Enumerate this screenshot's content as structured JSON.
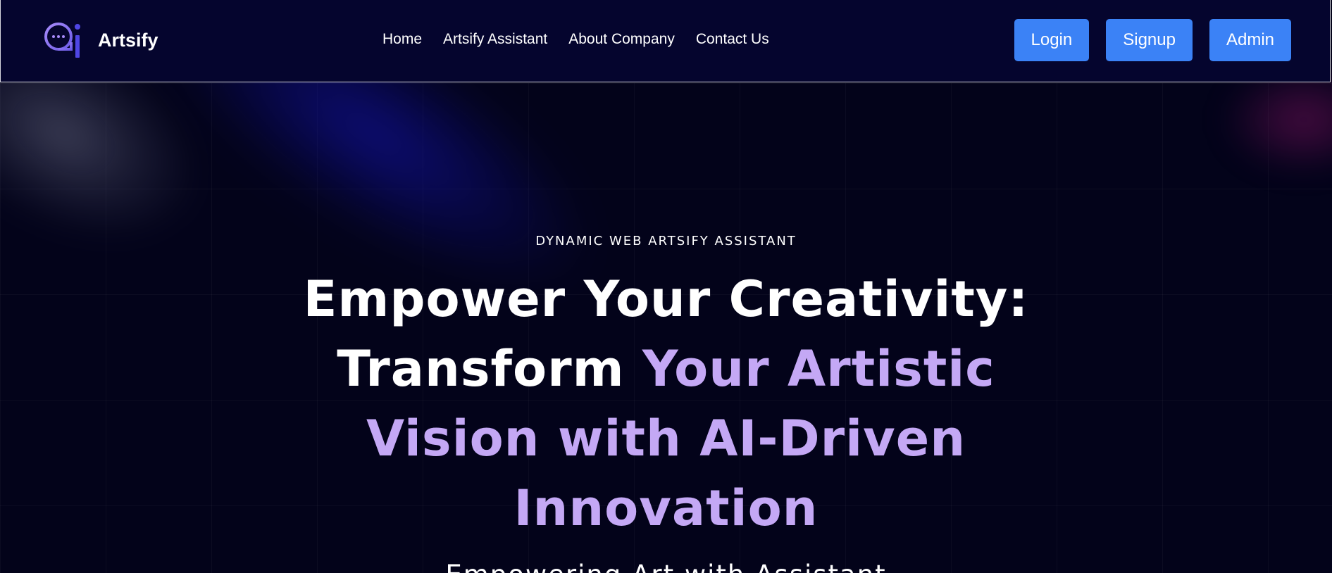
{
  "brand": {
    "name": "Artsify",
    "logo_icon": "chat-bubble-i-logo-icon",
    "logo_colors": [
      "#a78bfa",
      "#4f46e5"
    ]
  },
  "nav": {
    "items": [
      {
        "label": "Home"
      },
      {
        "label": "Artsify Assistant"
      },
      {
        "label": "About Company"
      },
      {
        "label": "Contact Us"
      }
    ]
  },
  "actions": {
    "login_label": "Login",
    "signup_label": "Signup",
    "admin_label": "Admin"
  },
  "hero": {
    "eyebrow": "DYNAMIC WEB ARTSIFY ASSISTANT",
    "headline_part1": "Empower Your Creativity: Transform ",
    "headline_part2": "Your Artistic Vision with AI-Driven Innovation",
    "subhead": "Empowering Art with Assistant"
  },
  "colors": {
    "background": "#03031a",
    "header_background": "#05052e",
    "button": "#3b82f6",
    "accent_text": "#c4a8f5"
  }
}
